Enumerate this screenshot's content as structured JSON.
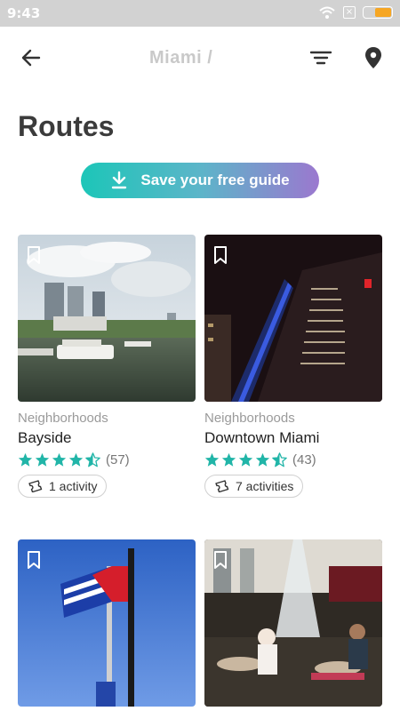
{
  "status": {
    "time": "9:43"
  },
  "appbar": {
    "title": "Miami /"
  },
  "page": {
    "title": "Routes"
  },
  "cta": {
    "label": "Save your free guide"
  },
  "cards": [
    {
      "category": "Neighborhoods",
      "name": "Bayside",
      "rating": 4.5,
      "count": "(57)",
      "activity": "1 activity"
    },
    {
      "category": "Neighborhoods",
      "name": "Downtown Miami",
      "rating": 4.5,
      "count": "(43)",
      "activity": "7 activities"
    },
    {
      "category": "",
      "name": "",
      "rating": null,
      "count": "",
      "activity": ""
    },
    {
      "category": "",
      "name": "",
      "rating": null,
      "count": "",
      "activity": ""
    }
  ],
  "colors": {
    "accent_start": "#1cc6b8",
    "accent_end": "#9b78cf",
    "star": "#21b5a8"
  }
}
